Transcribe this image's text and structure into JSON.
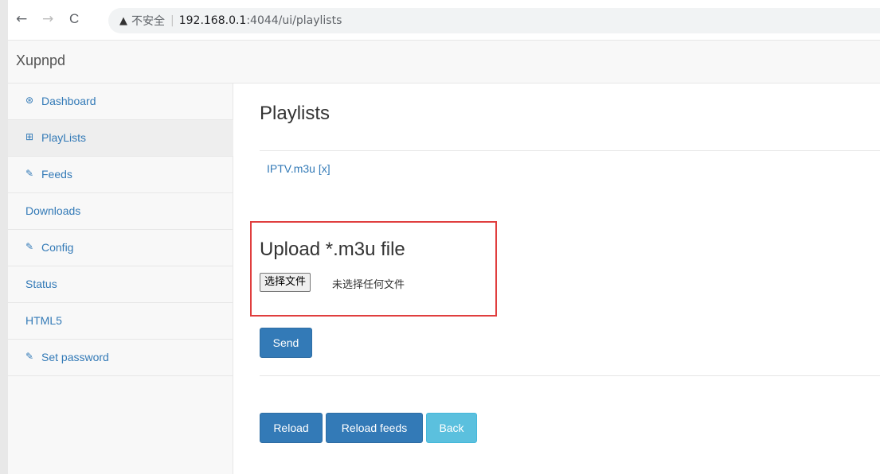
{
  "browser": {
    "back_glyph": "←",
    "forward_glyph": "→",
    "reload_glyph": "C",
    "warning_glyph": "▲",
    "insecure_label": "不安全",
    "url_host": "192.168.0.1",
    "url_path": ":4044/ui/playlists"
  },
  "navbar": {
    "brand": "Xupnpd"
  },
  "sidebar": {
    "items": [
      {
        "label": "Dashboard",
        "icon": "dashboard-icon",
        "glyph": "⊛",
        "active": false
      },
      {
        "label": "PlayLists",
        "icon": "table-icon",
        "glyph": "⊞",
        "active": true
      },
      {
        "label": "Feeds",
        "icon": "edit-icon",
        "glyph": "✎",
        "active": false
      },
      {
        "label": "Downloads",
        "icon": "",
        "glyph": "",
        "active": false
      },
      {
        "label": "Config",
        "icon": "edit-icon",
        "glyph": "✎",
        "active": false
      },
      {
        "label": "Status",
        "icon": "",
        "glyph": "",
        "active": false
      },
      {
        "label": "HTML5",
        "icon": "",
        "glyph": "",
        "active": false
      },
      {
        "label": "Set password",
        "icon": "edit-icon",
        "glyph": "✎",
        "active": false
      }
    ]
  },
  "main": {
    "title": "Playlists",
    "playlist": {
      "name": "IPTV.m3u",
      "delete_label": "[x]"
    },
    "upload": {
      "title": "Upload *.m3u file",
      "choose_label": "选择文件",
      "status": "未选择任何文件"
    },
    "send_label": "Send",
    "reload_label": "Reload",
    "reload_feeds_label": "Reload feeds",
    "back_label": "Back"
  },
  "colors": {
    "link": "#337ab7",
    "primary_button": "#337ab7",
    "info_button": "#5bc0de",
    "highlight_border": "#e03e3e"
  }
}
